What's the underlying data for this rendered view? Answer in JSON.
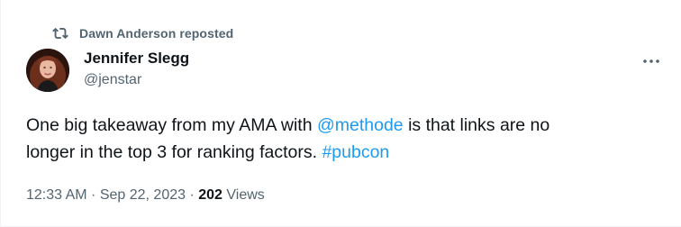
{
  "repost": {
    "icon": "repost-icon",
    "text": "Dawn Anderson reposted"
  },
  "author": {
    "name": "Jennifer Slegg",
    "handle": "@jenstar",
    "avatar_icon": "avatar"
  },
  "more_icon": "more-options-icon",
  "tweet": {
    "line1_a": "One big takeaway from my AMA with ",
    "mention": "@methode",
    "line1_b": " is that links are no",
    "line2": "longer in the top 3 for ranking factors. ",
    "hashtag": "#pubcon"
  },
  "meta": {
    "time": "12:33 AM",
    "sep1": " · ",
    "date": "Sep 22, 2023",
    "sep2": " · ",
    "views_count": "202",
    "views_label": " Views"
  },
  "colors": {
    "link": "#1d9bf0",
    "text": "#0f1419",
    "secondary": "#536471"
  }
}
